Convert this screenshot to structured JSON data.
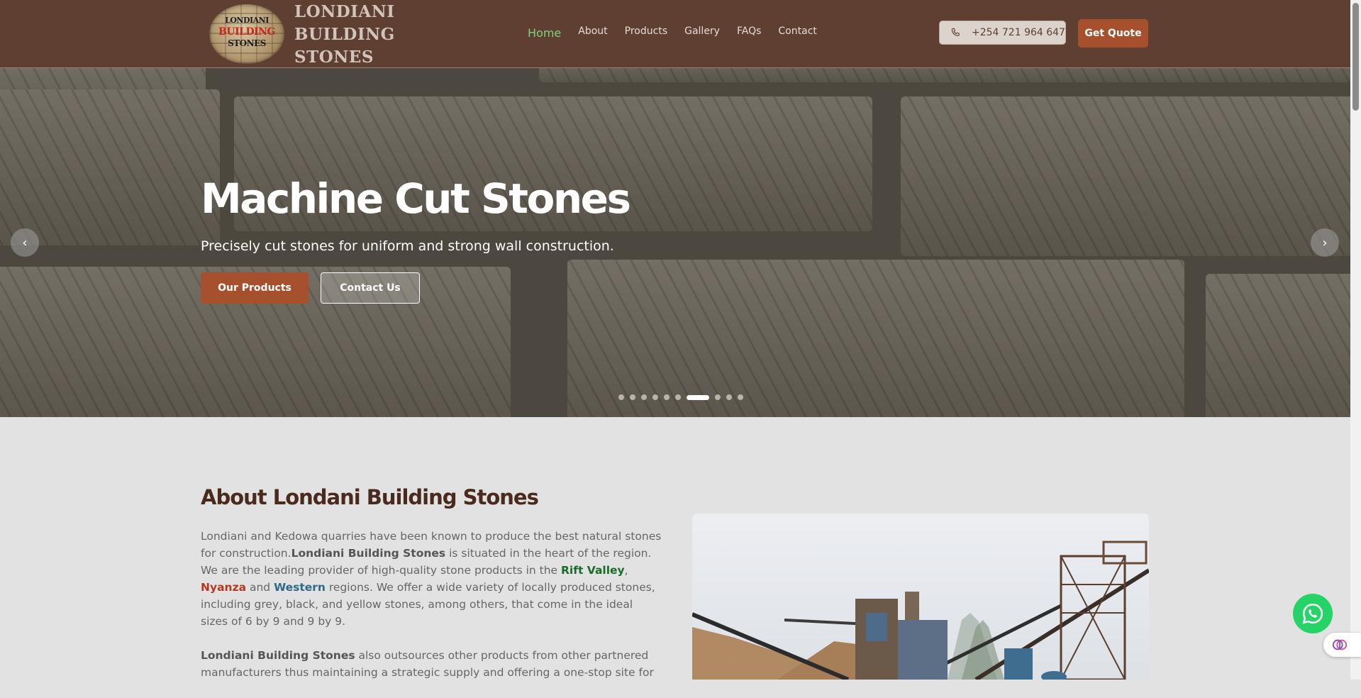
{
  "brand": {
    "badge_line1": "LONDIANI",
    "badge_line2": "BUILDING",
    "badge_line3": "STONES",
    "name_line1": "LONDIANI",
    "name_line2": "BUILDING",
    "name_line3": "STONES"
  },
  "nav": {
    "items": [
      {
        "label": "Home",
        "active": true
      },
      {
        "label": "About"
      },
      {
        "label": "Products"
      },
      {
        "label": "Gallery"
      },
      {
        "label": "FAQs"
      },
      {
        "label": "Contact"
      }
    ]
  },
  "header": {
    "phone": "+254 721 964 647",
    "phone_icon": "phone-icon",
    "quote_label": "Get Quote"
  },
  "hero": {
    "title": "Machine Cut Stones",
    "subtitle": "Precisely cut stones for uniform and strong wall construction.",
    "primary_button": "Our Products",
    "secondary_button": "Contact Us",
    "prev_icon": "chevron-left-icon",
    "next_icon": "chevron-right-icon",
    "prev_glyph": "‹",
    "next_glyph": "›",
    "slide_count": 10,
    "active_slide": 7
  },
  "about": {
    "title": "About Londani Building Stones",
    "p1_a": "Londiani and Kedowa quarries have been known to produce the best natural stones for construction.",
    "p1_brand": "Londiani Building Stones",
    "p1_b": " is situated in the heart of the region. We are the leading provider of high-quality stone products in the ",
    "region1": "Rift Valley",
    "sep1": ", ",
    "region2": "Nyanza",
    "sep2": " and ",
    "region3": "Western",
    "p1_c": " regions. We offer a wide variety of locally produced stones, including grey, black, and yellow stones, among others, that come in the ideal sizes of 6 by 9 and 9 by 9.",
    "p2_brand": "Londiani Building Stones",
    "p2_a": " also outsources other products from other partnered manufacturers thus maintaining a strategic supply and offering a one-stop site for"
  },
  "floating": {
    "whatsapp_icon": "whatsapp-icon",
    "assistant_icon": "brain-icon"
  },
  "colors": {
    "header_bg": "#5e3f31",
    "accent": "#a7502d",
    "nav_active": "#7fd17f",
    "heading": "#4b2a1e",
    "rift_valley": "#1a6b2a",
    "nyanza": "#b5391f",
    "western": "#2a6b86",
    "whatsapp": "#25d366"
  }
}
